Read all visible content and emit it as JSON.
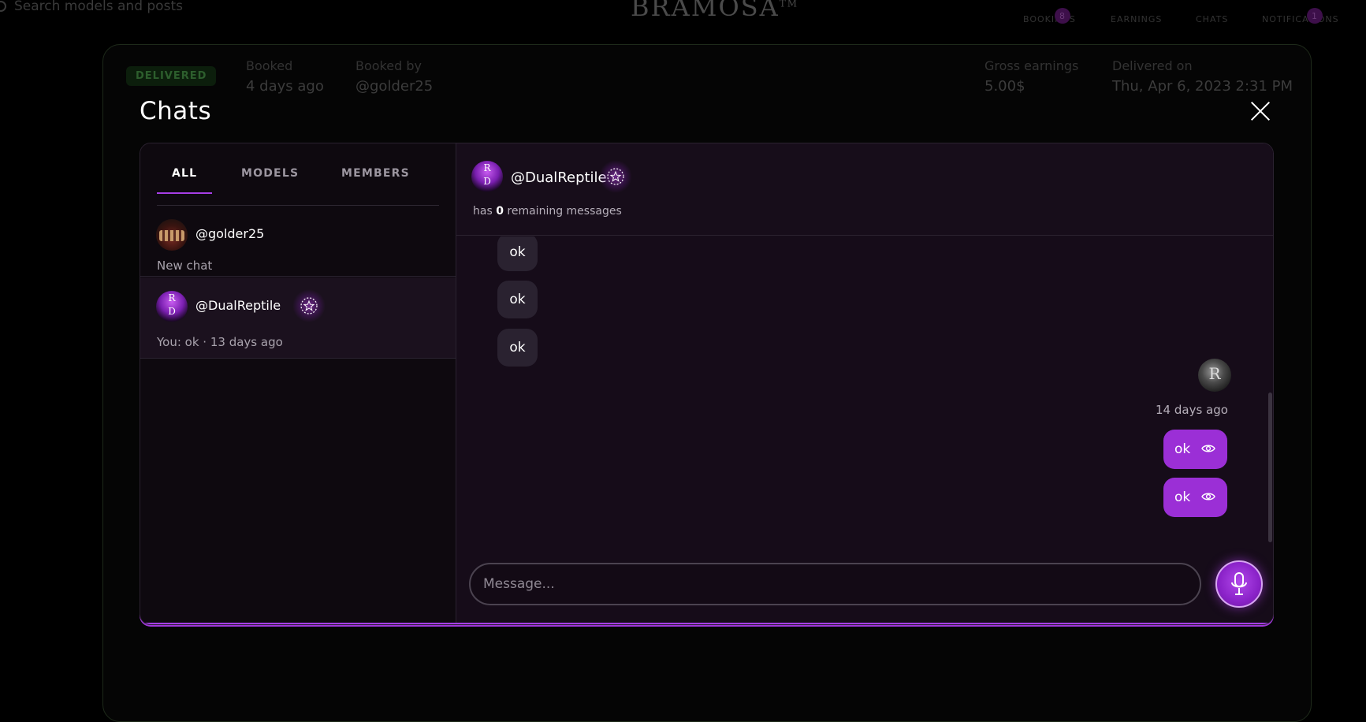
{
  "background": {
    "search_placeholder": "Search models and posts",
    "logo": "BRAMOSA",
    "logo_tm": "TM",
    "nav": [
      {
        "label": "BOOKINGS",
        "badge": "8"
      },
      {
        "label": "EARNINGS",
        "badge": ""
      },
      {
        "label": "CHATS",
        "badge": ""
      },
      {
        "label": "NOTIFICATIONS",
        "badge": "1"
      }
    ],
    "status_pill": "DELIVERED",
    "booked_label": "Booked",
    "booked_value": "4 days ago",
    "booked_by_label": "Booked by",
    "booked_by_value": "@golder25",
    "gross_label": "Gross earnings",
    "gross_value": "5.00$",
    "delivered_label": "Delivered on",
    "delivered_value": "Thu, Apr 6, 2023 2:31 PM"
  },
  "modal": {
    "title": "Chats",
    "tabs": [
      {
        "label": "ALL",
        "active": true
      },
      {
        "label": "MODELS",
        "active": false
      },
      {
        "label": "MEMBERS",
        "active": false
      }
    ],
    "conversations": [
      {
        "name": "@golder25",
        "preview": "New chat",
        "selected": false
      },
      {
        "name": "@DualReptile",
        "preview": "You: ok · 13 days ago",
        "selected": true,
        "avatar_letters": [
          "R",
          "D"
        ]
      }
    ],
    "thread": {
      "name": "@DualReptile",
      "remaining_prefix": "has",
      "remaining_count": "0",
      "remaining_suffix": "remaining messages",
      "incoming": [
        "ok",
        "ok",
        "ok"
      ],
      "my_avatar_letter": "R",
      "time": "14 days ago",
      "outgoing": [
        "ok",
        "ok"
      ]
    },
    "composer_placeholder": "Message..."
  },
  "colors": {
    "accent": "#a63ee6",
    "outgoing_bubble": "#9b2fd6",
    "incoming_bubble": "#2a2230",
    "panel_bg": "#120b14"
  }
}
